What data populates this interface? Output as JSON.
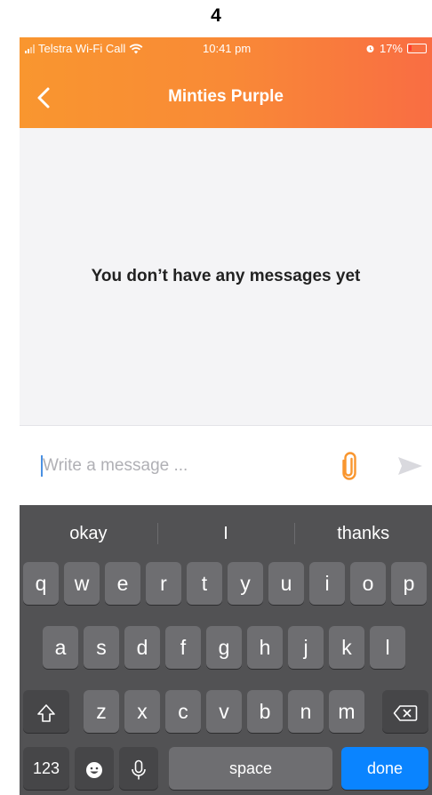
{
  "page_number": "4",
  "status_bar": {
    "carrier": "Telstra Wi-Fi Call",
    "time": "10:41 pm",
    "battery": "17%",
    "icons": [
      "signal-icon",
      "wifi-icon",
      "alarm-icon",
      "battery-icon"
    ]
  },
  "header": {
    "title": "Minties Purple",
    "back_icon": "back-chevron-icon",
    "gradient": [
      "#f9962f",
      "#f96d43"
    ]
  },
  "messages": {
    "empty_text": "You don’t have any messages yet"
  },
  "composer": {
    "placeholder": "Write a message ...",
    "attach_icon": "paperclip-icon",
    "send_icon": "send-icon",
    "accent_color": "#f9962f"
  },
  "keyboard": {
    "suggestions": [
      "okay",
      "I",
      "thanks"
    ],
    "row1": [
      "q",
      "w",
      "e",
      "r",
      "t",
      "y",
      "u",
      "i",
      "o",
      "p"
    ],
    "row2": [
      "a",
      "s",
      "d",
      "f",
      "g",
      "h",
      "j",
      "k",
      "l"
    ],
    "row3": [
      "z",
      "x",
      "c",
      "v",
      "b",
      "n",
      "m"
    ],
    "numbers_label": "123",
    "space_label": "space",
    "done_label": "done",
    "done_color": "#0a84ff"
  }
}
